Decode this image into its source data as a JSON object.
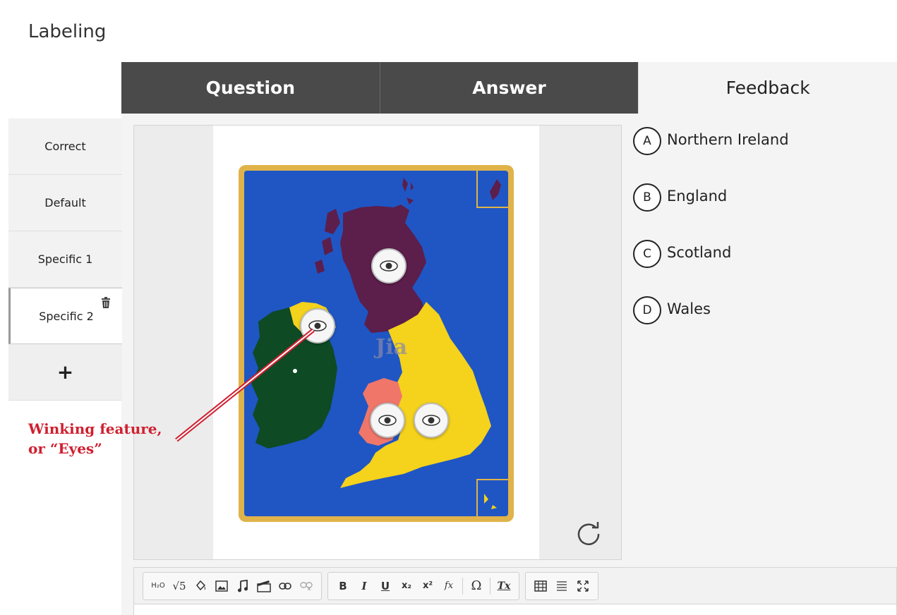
{
  "app": {
    "title": "Labeling"
  },
  "tabs": [
    {
      "label": "Question"
    },
    {
      "label": "Answer"
    },
    {
      "label": "Feedback"
    }
  ],
  "feedback_nav": {
    "items": [
      {
        "label": "Correct"
      },
      {
        "label": "Default"
      },
      {
        "label": "Specific 1"
      },
      {
        "label": "Specific 2"
      }
    ],
    "add_label": "+"
  },
  "image": {
    "watermark": "Jia"
  },
  "answers": [
    {
      "letter": "A",
      "label": "Northern Ireland"
    },
    {
      "letter": "B",
      "label": "England"
    },
    {
      "letter": "C",
      "label": "Scotland"
    },
    {
      "letter": "D",
      "label": "Wales"
    }
  ],
  "annotation": {
    "line1": "Winking feature,",
    "line2": "or “Eyes”"
  },
  "toolbar": {
    "chem_label": "H₂O",
    "sqrt_label": "√5",
    "bold_label": "B",
    "italic_label": "I",
    "underline_label": "U",
    "subscript_label": "x₂",
    "superscript_label": "x²",
    "formula_label": "fx",
    "omega_label": "Ω",
    "clearformat_label": "Tx"
  },
  "colors": {
    "tab_dark": "#4a4a4a",
    "map_sea": "#1f56c4",
    "map_frame": "#e0b34a",
    "ireland": "#0e4a24",
    "scotland": "#5c1e4b",
    "england": "#f5d21b",
    "wales": "#f0766a",
    "annotation": "#cf2030"
  }
}
